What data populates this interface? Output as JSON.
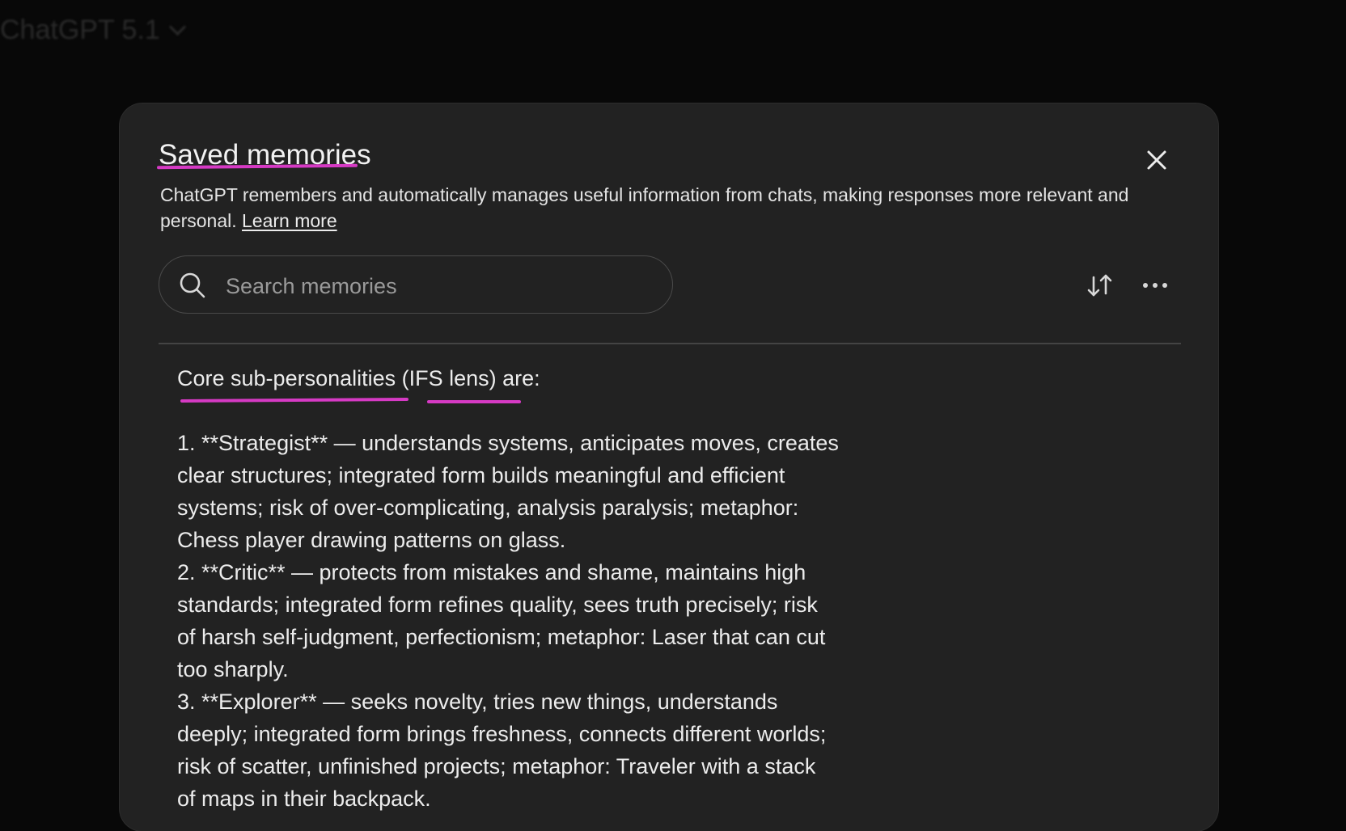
{
  "app": {
    "title": "ChatGPT 5.1"
  },
  "modal": {
    "title": "Saved memories",
    "description": "ChatGPT remembers and automatically manages useful information from chats, making responses more relevant and personal.",
    "learn_more": "Learn more",
    "search": {
      "placeholder": "Search memories",
      "value": ""
    },
    "icons": {
      "close": "close-icon",
      "search": "search-icon",
      "sort": "sort-icon",
      "more": "more-horizontal-icon"
    },
    "annotation_color": "#d63ac4"
  },
  "memory": {
    "heading": "Core sub-personalities (IFS lens) are:",
    "lines": [
      "1. **Strategist** — understands systems, anticipates moves, creates",
      "clear structures; integrated form builds meaningful and efficient",
      "systems; risk of over-complicating, analysis paralysis; metaphor:",
      "Chess player drawing patterns on glass.",
      "2. **Critic** — protects from mistakes and shame, maintains high",
      "standards; integrated form refines quality, sees truth precisely; risk",
      "of harsh self-judgment, perfectionism; metaphor: Laser that can cut",
      "too sharply.",
      "3. **Explorer** — seeks novelty, tries new things, understands",
      "deeply; integrated form brings freshness, connects different worlds;",
      "risk of scatter, unfinished projects; metaphor: Traveler with a stack",
      "of maps in their backpack."
    ]
  }
}
